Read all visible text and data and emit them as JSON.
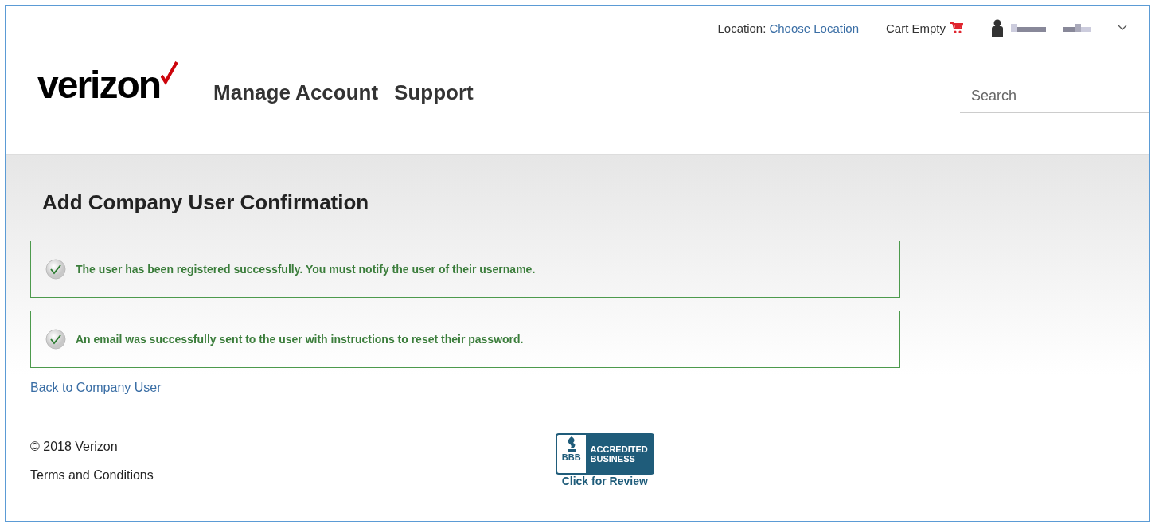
{
  "utility_bar": {
    "location_label": "Location:",
    "location_link": "Choose Location",
    "cart": "Cart Empty"
  },
  "header": {
    "logo": "verizon",
    "nav": [
      {
        "label": "Manage Account"
      },
      {
        "label": "Support"
      }
    ],
    "search": {
      "placeholder": "Search"
    }
  },
  "page": {
    "title": "Add Company User Confirmation",
    "messages": [
      {
        "text": "The user has been registered successfully. You must notify the user of their username."
      },
      {
        "text": "An email was successfully sent to the user with instructions to reset their password."
      }
    ],
    "back_link": "Back to Company User"
  },
  "footer": {
    "copyright": "© 2018 Verizon",
    "terms": "Terms and Conditions",
    "badge": {
      "mark": "BBB",
      "line_1": "ACCREDITED",
      "line_2": "BUSINESS",
      "caption": "Click for Review"
    }
  }
}
